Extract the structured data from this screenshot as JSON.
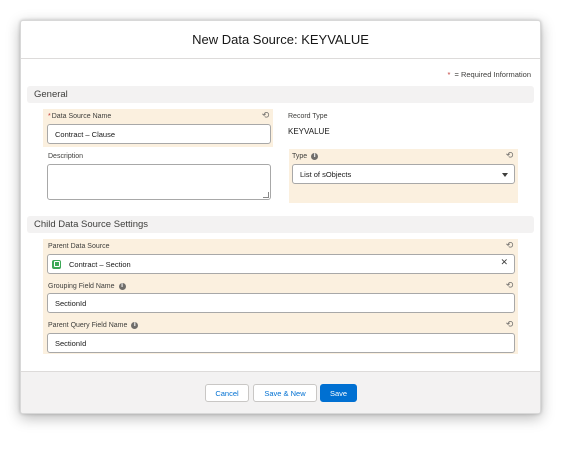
{
  "modal": {
    "title": "New Data Source: KEYVALUE",
    "required_star": "*",
    "required_note": "= Required Information"
  },
  "general": {
    "section_title": "General",
    "data_source_name": {
      "required": "*",
      "label": "Data Source Name",
      "value": "Contract – Clause"
    },
    "record_type": {
      "label": "Record Type",
      "value": "KEYVALUE"
    },
    "description": {
      "label": "Description",
      "value": ""
    },
    "type": {
      "label": "Type",
      "value": "List of sObjects"
    }
  },
  "child": {
    "section_title": "Child Data Source Settings",
    "parent_data_source": {
      "label": "Parent Data Source",
      "value": "Contract – Section"
    },
    "grouping_field_name": {
      "label": "Grouping Field Name",
      "value": "SectionId"
    },
    "parent_query_field_name": {
      "label": "Parent Query Field Name",
      "value": "SectionId"
    }
  },
  "footer": {
    "cancel": "Cancel",
    "save_new": "Save & New",
    "save": "Save"
  },
  "icons": {
    "info": "info-icon",
    "undo": "undo-icon",
    "dropdown": "chevron-down-icon",
    "lookup": "data-source-icon",
    "clear": "close-icon"
  },
  "colors": {
    "accent": "#0070d2",
    "highlight": "#fbf0df",
    "required": "#c23934",
    "lookup_icon": "#3ba755"
  }
}
